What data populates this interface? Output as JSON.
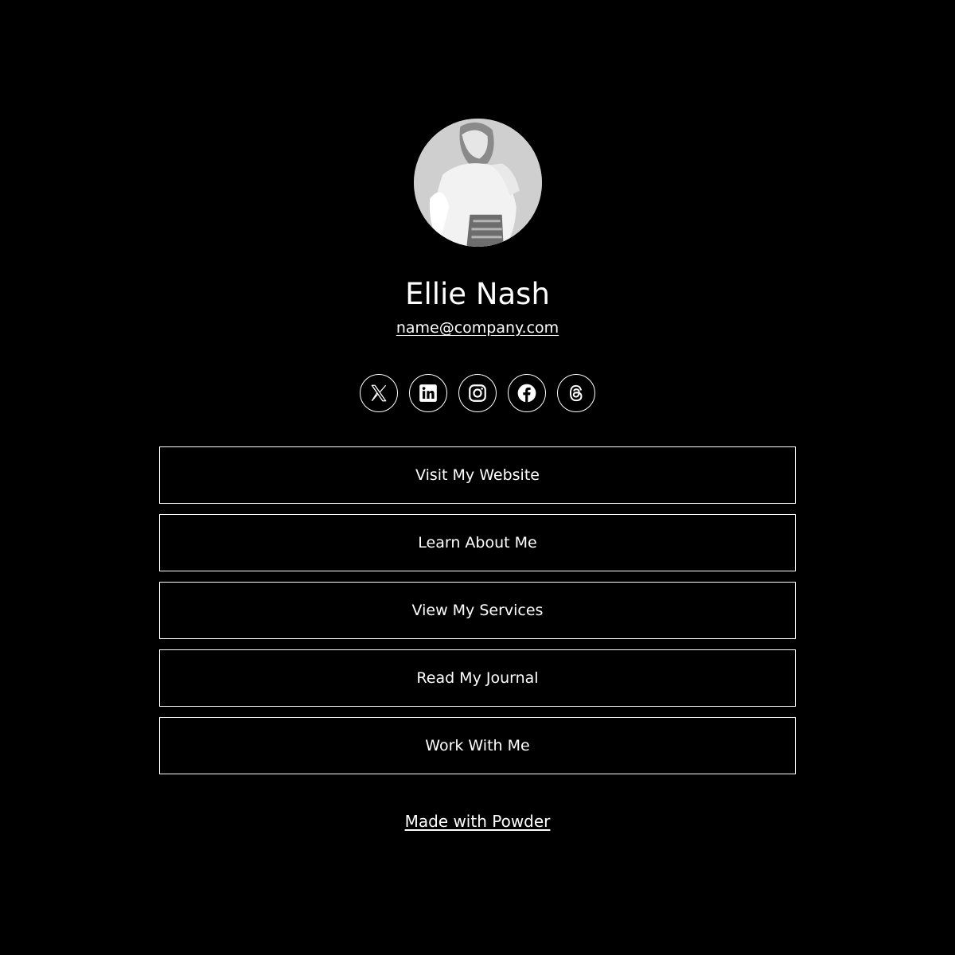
{
  "profile": {
    "name": "Ellie Nash",
    "email": "name@company.com",
    "avatar_alt": "Black and white photo of a woman in a white lace blouse"
  },
  "socials": [
    {
      "network": "X",
      "icon": "x-icon"
    },
    {
      "network": "LinkedIn",
      "icon": "linkedin-icon"
    },
    {
      "network": "Instagram",
      "icon": "instagram-icon"
    },
    {
      "network": "Facebook",
      "icon": "facebook-icon"
    },
    {
      "network": "Threads",
      "icon": "threads-icon"
    }
  ],
  "links": [
    {
      "label": "Visit My Website"
    },
    {
      "label": "Learn About Me"
    },
    {
      "label": "View My Services"
    },
    {
      "label": "Read My Journal"
    },
    {
      "label": "Work With Me"
    }
  ],
  "footer": {
    "label": "Made with Powder"
  },
  "colors": {
    "background": "#000000",
    "foreground": "#ffffff"
  }
}
